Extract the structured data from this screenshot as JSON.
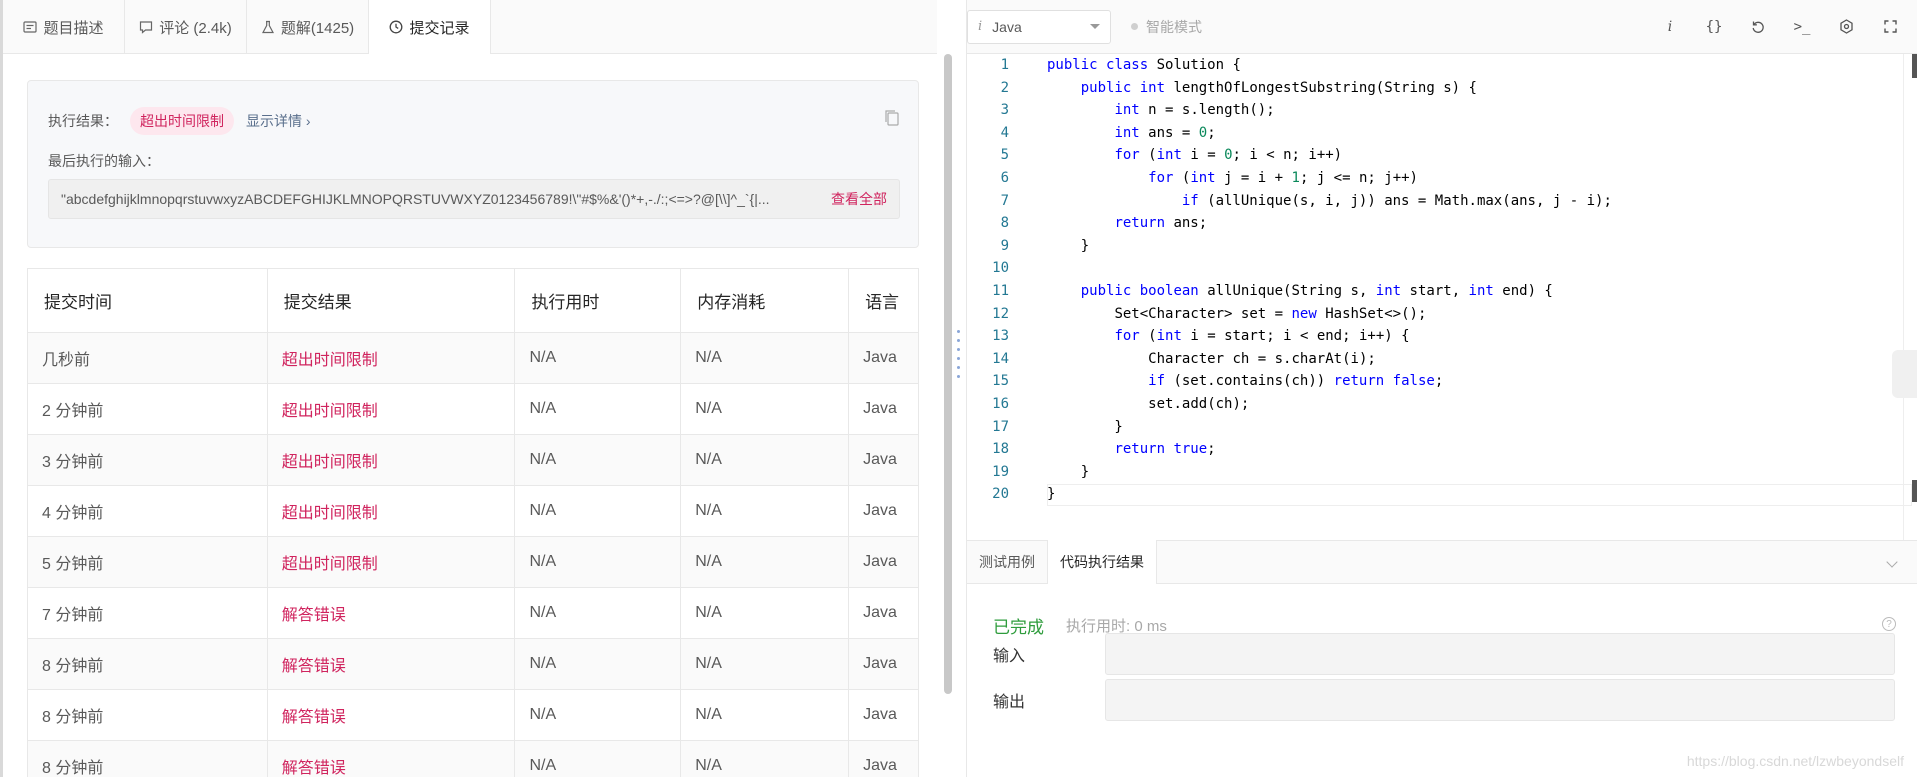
{
  "tabs": [
    {
      "label": "题目描述",
      "icon": "description-icon"
    },
    {
      "label": "评论 (2.4k)",
      "icon": "comment-icon"
    },
    {
      "label": "题解(1425)",
      "icon": "flask-icon"
    },
    {
      "label": "提交记录",
      "icon": "clock-icon"
    }
  ],
  "result": {
    "label": "执行结果：",
    "status": "超出时间限制",
    "detail_link": "显示详情 ›",
    "last_input_label": "最后执行的输入：",
    "last_input_value": "\"abcdefghijklmnopqrstuvwxyzABCDEFGHIJKLMNOPQRSTUVWXYZ0123456789!\\\"#$%&'()*+,-./:;<=>?@[\\\\]^_`{|...",
    "view_all": "查看全部"
  },
  "table": {
    "headers": [
      "提交时间",
      "提交结果",
      "执行用时",
      "内存消耗",
      "语言"
    ],
    "rows": [
      {
        "time": "几秒前",
        "result": "超出时间限制",
        "runtime": "N/A",
        "memory": "N/A",
        "lang": "Java"
      },
      {
        "time": "2 分钟前",
        "result": "超出时间限制",
        "runtime": "N/A",
        "memory": "N/A",
        "lang": "Java"
      },
      {
        "time": "3 分钟前",
        "result": "超出时间限制",
        "runtime": "N/A",
        "memory": "N/A",
        "lang": "Java"
      },
      {
        "time": "4 分钟前",
        "result": "超出时间限制",
        "runtime": "N/A",
        "memory": "N/A",
        "lang": "Java"
      },
      {
        "time": "5 分钟前",
        "result": "超出时间限制",
        "runtime": "N/A",
        "memory": "N/A",
        "lang": "Java"
      },
      {
        "time": "7 分钟前",
        "result": "解答错误",
        "runtime": "N/A",
        "memory": "N/A",
        "lang": "Java"
      },
      {
        "time": "8 分钟前",
        "result": "解答错误",
        "runtime": "N/A",
        "memory": "N/A",
        "lang": "Java"
      },
      {
        "time": "8 分钟前",
        "result": "解答错误",
        "runtime": "N/A",
        "memory": "N/A",
        "lang": "Java"
      },
      {
        "time": "8 分钟前",
        "result": "解答错误",
        "runtime": "N/A",
        "memory": "N/A",
        "lang": "Java"
      }
    ]
  },
  "editor": {
    "language": "Java",
    "smart_mode": "智能模式",
    "toolbar_icons": [
      "info-icon",
      "format-braces-icon",
      "reset-icon",
      "console-icon",
      "settings-icon",
      "fullscreen-icon"
    ],
    "lines": [
      "public class Solution {",
      "    public int lengthOfLongestSubstring(String s) {",
      "        int n = s.length();",
      "        int ans = 0;",
      "        for (int i = 0; i < n; i++)",
      "            for (int j = i + 1; j <= n; j++)",
      "                if (allUnique(s, i, j)) ans = Math.max(ans, j - i);",
      "        return ans;",
      "    }",
      "",
      "    public boolean allUnique(String s, int start, int end) {",
      "        Set<Character> set = new HashSet<>();",
      "        for (int i = start; i < end; i++) {",
      "            Character ch = s.charAt(i);",
      "            if (set.contains(ch)) return false;",
      "            set.add(ch);",
      "        }",
      "        return true;",
      "    }",
      "}"
    ]
  },
  "console": {
    "tabs": [
      "测试用例",
      "代码执行结果"
    ],
    "status": "已完成",
    "exec_time": "执行用时: 0 ms",
    "input_label": "输入",
    "output_label": "输出",
    "watermark": "https://blog.csdn.net/lzwbeyondself"
  },
  "colors": {
    "accent_red": "#d0245e",
    "success_green": "#2e9c3c",
    "keyword_blue": "#0000ff",
    "number_green": "#09885a",
    "line_number": "#237893"
  }
}
